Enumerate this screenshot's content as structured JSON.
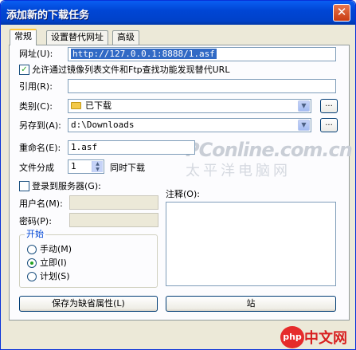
{
  "window": {
    "title": "添加新的下载任务",
    "close_glyph": "✕"
  },
  "tabs": [
    {
      "label": "常规",
      "active": true
    },
    {
      "label": "设置替代网址",
      "active": false
    },
    {
      "label": "高级",
      "active": false
    }
  ],
  "form": {
    "url": {
      "label": "网址(U):",
      "key": "U",
      "value": "http://127.0.0.1:8888/1.asf"
    },
    "mirror_checkbox": {
      "label": "允许通过镜像列表文件和Ftp查找功能发现替代URL",
      "checked": true,
      "check_glyph": "✓"
    },
    "referer": {
      "label": "引用(R):",
      "key": "R",
      "value": ""
    },
    "category": {
      "label": "类别(C):",
      "key": "C",
      "value": "已下载",
      "browse_label": "..."
    },
    "save_to": {
      "label": "另存到(A):",
      "key": "A",
      "value": "d:\\Downloads",
      "browse_label": "..."
    },
    "rename": {
      "label": "重命名(E):",
      "key": "E",
      "value": "1.asf"
    },
    "split": {
      "label": "文件分成",
      "value": "1",
      "suffix": "同时下载",
      "up": "▲",
      "down": "▼"
    },
    "login": {
      "label": "登录到服务器(G):",
      "key": "G",
      "checked": false
    },
    "username": {
      "label": "用户名(M):",
      "key": "M",
      "value": ""
    },
    "password": {
      "label": "密码(P):",
      "key": "P",
      "value": ""
    },
    "comment": {
      "label": "注释(O):",
      "key": "O",
      "value": ""
    },
    "start_group": {
      "title": "开始",
      "options": [
        {
          "label": "手动(M)",
          "key": "M",
          "selected": false
        },
        {
          "label": "立即(I)",
          "key": "I",
          "selected": true
        },
        {
          "label": "计划(S)",
          "key": "S",
          "selected": false
        }
      ]
    },
    "save_default_button": {
      "label": "保存为缺省属性(L)",
      "key": "L"
    },
    "start_button": {
      "label": "站"
    }
  },
  "watermark": {
    "line1": "PConline.com.cn",
    "line2": "太平洋电脑网"
  },
  "logo": {
    "circle_text": "php",
    "text": "中文网"
  },
  "dropdown_glyph": "▼"
}
